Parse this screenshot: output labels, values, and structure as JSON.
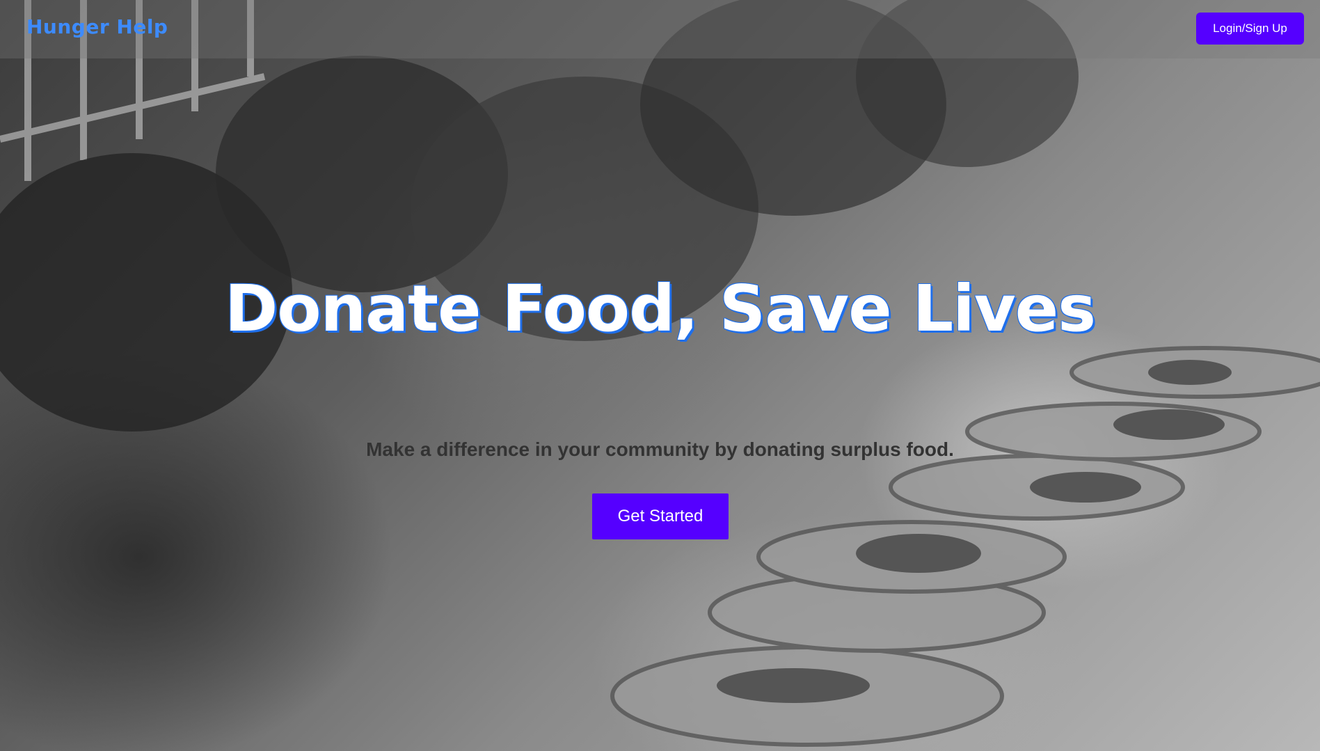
{
  "colors": {
    "brand": "#3d8bfd",
    "accent": "#5500ff",
    "headline": "#ffffff",
    "headline_outline": "#1f6feb",
    "subtitle": "#333333"
  },
  "navbar": {
    "brand": "Hunger Help",
    "login_label": "Login/Sign Up"
  },
  "hero": {
    "background_image": "children-eating-photo",
    "headline": "Donate Food, Save Lives",
    "subtitle": "Make a difference in your community by donating surplus food.",
    "cta_label": "Get Started"
  }
}
